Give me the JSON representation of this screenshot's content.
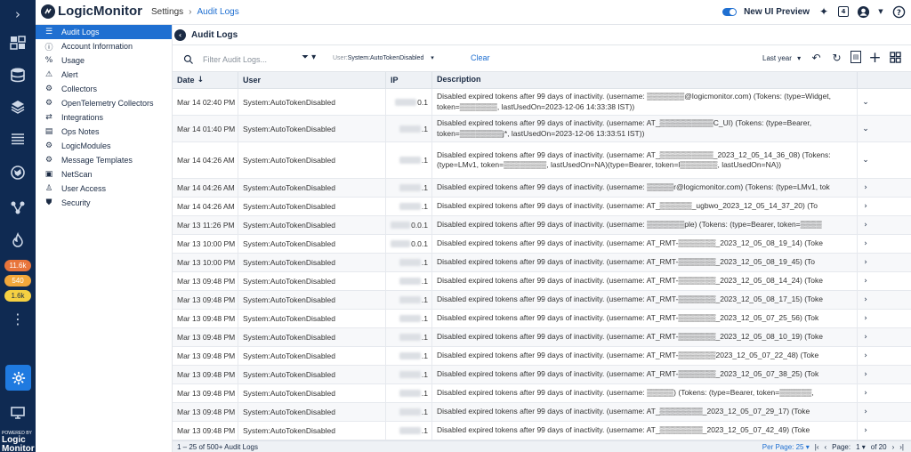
{
  "rail": {
    "badges": [
      {
        "text": "11.6k",
        "color": "#e8743b",
        "fg": "#ffffff"
      },
      {
        "text": "540",
        "color": "#f2a73b",
        "fg": "#ffffff"
      },
      {
        "text": "1.6k",
        "color": "#f5d042",
        "fg": "#1b2b44"
      }
    ],
    "powered_small": "POWERED BY",
    "powered_big1": "Logic",
    "powered_big2": "Monitor"
  },
  "topbar": {
    "logo": "LogicMonitor",
    "crumb_settings": "Settings",
    "crumb_current": "Audit Logs",
    "new_ui": "New UI Preview"
  },
  "sidebar": {
    "items": [
      {
        "label": "Audit Logs",
        "icon": "audit-icon"
      },
      {
        "label": "Account Information",
        "icon": "info-icon"
      },
      {
        "label": "Usage",
        "icon": "usage-icon"
      },
      {
        "label": "Alert",
        "icon": "bell-icon"
      },
      {
        "label": "Collectors",
        "icon": "collector-icon"
      },
      {
        "label": "OpenTelemetry Collectors",
        "icon": "gear-icon"
      },
      {
        "label": "Integrations",
        "icon": "integrations-icon"
      },
      {
        "label": "Ops Notes",
        "icon": "notes-icon"
      },
      {
        "label": "LogicModules",
        "icon": "gear-icon"
      },
      {
        "label": "Message Templates",
        "icon": "gear-icon"
      },
      {
        "label": "NetScan",
        "icon": "netscan-icon"
      },
      {
        "label": "User Access",
        "icon": "user-access-icon"
      },
      {
        "label": "Security",
        "icon": "shield-icon"
      }
    ]
  },
  "main": {
    "title": "Audit Logs",
    "search_placeholder": "Filter Audit Logs...",
    "chip_key": "User:",
    "chip_value": "System:AutoTokenDisabled",
    "clear": "Clear",
    "range": "Last year"
  },
  "table": {
    "headers": {
      "date": "Date",
      "user": "User",
      "ip": "IP",
      "desc": "Description"
    },
    "rows": [
      {
        "date": "Mar 14 02:40 PM",
        "user": "System:AutoTokenDisabled",
        "ip": "0.1",
        "desc": "Disabled expired tokens after 99 days of inactivity. (username: ▒▒▒▒▒▒▒@logicmonitor.com) (Tokens: (type=Widget, token=▒▒▒▒▒▒▒, lastUsedOn=2023-12-06 14:33:38 IST))",
        "exp": "⌄",
        "h": 30
      },
      {
        "date": "Mar 14 01:40 PM",
        "user": "System:AutoTokenDisabled",
        "ip": ".1",
        "desc": "Disabled expired tokens after 99 days of inactivity. (username: AT_▒▒▒▒▒▒▒▒▒▒C_UI) (Tokens: (type=Bearer, token=▒▒▒▒▒▒▒▒j*, lastUsedOn=2023-12-06 13:33:51 IST))",
        "exp": "⌄",
        "h": 30
      },
      {
        "date": "Mar 14 04:26 AM",
        "user": "System:AutoTokenDisabled",
        "ip": ".1",
        "desc": "Disabled expired tokens after 99 days of inactivity. (username: AT_▒▒▒▒▒▒▒▒▒▒_2023_12_05_14_36_08) (Tokens: (type=LMv1, token=▒▒▒▒▒▒▒▒, lastUsedOn=NA)(type=Bearer, token=l▒▒▒▒▒▒▒, lastUsedOn=NA))",
        "exp": "⌄",
        "h": 41
      },
      {
        "date": "Mar 14 04:26 AM",
        "user": "System:AutoTokenDisabled",
        "ip": ".1",
        "desc": "Disabled expired tokens after 99 days of inactivity. (username: ▒▒▒▒▒r@logicmonitor.com) (Tokens: (type=LMv1, tok",
        "exp": "›",
        "h": 21
      },
      {
        "date": "Mar 14 04:26 AM",
        "user": "System:AutoTokenDisabled",
        "ip": ".1",
        "desc": "Disabled expired tokens after 99 days of inactivity. (username: AT_▒▒▒▒▒▒_ugbwo_2023_12_05_14_37_20) (To",
        "exp": "›",
        "h": 21
      },
      {
        "date": "Mar 13 11:26 PM",
        "user": "System:AutoTokenDisabled",
        "ip": "0.0.1",
        "desc": "Disabled expired tokens after 99 days of inactivity. (username: ▒▒▒▒▒▒▒ple) (Tokens: (type=Bearer, token=▒▒▒▒",
        "exp": "›",
        "h": 21
      },
      {
        "date": "Mar 13 10:00 PM",
        "user": "System:AutoTokenDisabled",
        "ip": "0.0.1",
        "desc": "Disabled expired tokens after 99 days of inactivity. (username: AT_RMT-▒▒▒▒▒▒▒_2023_12_05_08_19_14) (Toke",
        "exp": "›",
        "h": 21
      },
      {
        "date": "Mar 13 10:00 PM",
        "user": "System:AutoTokenDisabled",
        "ip": ".1",
        "desc": "Disabled expired tokens after 99 days of inactivity. (username: AT_RMT-▒▒▒▒▒▒▒_2023_12_05_08_19_45) (To",
        "exp": "›",
        "h": 21
      },
      {
        "date": "Mar 13 09:48 PM",
        "user": "System:AutoTokenDisabled",
        "ip": ".1",
        "desc": "Disabled expired tokens after 99 days of inactivity. (username: AT_RMT-▒▒▒▒▒▒▒_2023_12_05_08_14_24) (Toke",
        "exp": "›",
        "h": 21
      },
      {
        "date": "Mar 13 09:48 PM",
        "user": "System:AutoTokenDisabled",
        "ip": ".1",
        "desc": "Disabled expired tokens after 99 days of inactivity. (username: AT_RMT-▒▒▒▒▒▒▒_2023_12_05_08_17_15) (Toke",
        "exp": "›",
        "h": 21
      },
      {
        "date": "Mar 13 09:48 PM",
        "user": "System:AutoTokenDisabled",
        "ip": ".1",
        "desc": "Disabled expired tokens after 99 days of inactivity. (username: AT_RMT-▒▒▒▒▒▒▒_2023_12_05_07_25_56) (Tok",
        "exp": "›",
        "h": 21
      },
      {
        "date": "Mar 13 09:48 PM",
        "user": "System:AutoTokenDisabled",
        "ip": ".1",
        "desc": "Disabled expired tokens after 99 days of inactivity. (username: AT_RMT-▒▒▒▒▒▒▒_2023_12_05_08_10_19) (Toke",
        "exp": "›",
        "h": 21
      },
      {
        "date": "Mar 13 09:48 PM",
        "user": "System:AutoTokenDisabled",
        "ip": ".1",
        "desc": "Disabled expired tokens after 99 days of inactivity. (username: AT_RMT-▒▒▒▒▒▒▒2023_12_05_07_22_48) (Toke",
        "exp": "›",
        "h": 21
      },
      {
        "date": "Mar 13 09:48 PM",
        "user": "System:AutoTokenDisabled",
        "ip": ".1",
        "desc": "Disabled expired tokens after 99 days of inactivity. (username: AT_RMT-▒▒▒▒▒▒▒_2023_12_05_07_38_25) (Tok",
        "exp": "›",
        "h": 21
      },
      {
        "date": "Mar 13 09:48 PM",
        "user": "System:AutoTokenDisabled",
        "ip": ".1",
        "desc": "Disabled expired tokens after 99 days of inactivity. (username: ▒▒▒▒▒) (Tokens: (type=Bearer, token=▒▒▒▒▒▒,",
        "exp": "›",
        "h": 21
      },
      {
        "date": "Mar 13 09:48 PM",
        "user": "System:AutoTokenDisabled",
        "ip": ".1",
        "desc": "Disabled expired tokens after 99 days of inactivity. (username: AT_▒▒▒▒▒▒▒▒_2023_12_05_07_29_17) (Toke",
        "exp": "›",
        "h": 21
      },
      {
        "date": "Mar 13 09:48 PM",
        "user": "System:AutoTokenDisabled",
        "ip": ".1",
        "desc": "Disabled expired tokens after 99 days of inactivity. (username: AT_▒▒▒▒▒▒▒▒_2023_12_05_07_42_49) (Toke",
        "exp": "›",
        "h": 21
      }
    ]
  },
  "footer": {
    "count": "1 – 25 of 500+ Audit Logs",
    "per_page": "Per Page: 25",
    "page_label": "Page:",
    "page_num": "1",
    "of_pages": "of 20"
  }
}
